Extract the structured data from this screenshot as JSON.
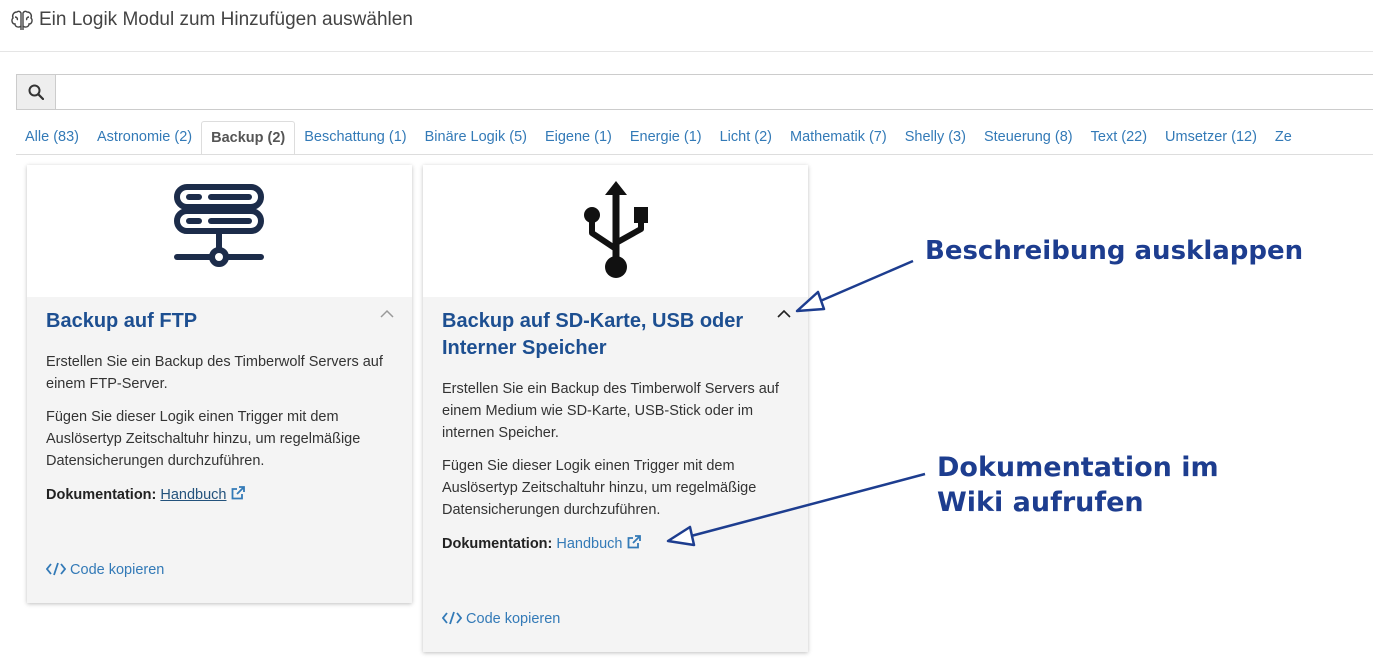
{
  "header": {
    "title": "Ein Logik Modul zum Hinzufügen auswählen",
    "icon": "brain-icon"
  },
  "search": {
    "value": "",
    "icon": "search-icon"
  },
  "tabs": [
    {
      "label": "Alle (83)",
      "active": false
    },
    {
      "label": "Astronomie (2)",
      "active": false
    },
    {
      "label": "Backup (2)",
      "active": true
    },
    {
      "label": "Beschattung (1)",
      "active": false
    },
    {
      "label": "Binäre Logik (5)",
      "active": false
    },
    {
      "label": "Eigene (1)",
      "active": false
    },
    {
      "label": "Energie (1)",
      "active": false
    },
    {
      "label": "Licht (2)",
      "active": false
    },
    {
      "label": "Mathematik (7)",
      "active": false
    },
    {
      "label": "Shelly (3)",
      "active": false
    },
    {
      "label": "Steuerung (8)",
      "active": false
    },
    {
      "label": "Text (22)",
      "active": false
    },
    {
      "label": "Umsetzer (12)",
      "active": false
    },
    {
      "label": "Ze",
      "active": false
    }
  ],
  "cards": [
    {
      "title": "Backup auf FTP",
      "icon": "server-network-icon",
      "desc1": "Erstellen Sie ein Backup des Timberwolf Servers auf einem FTP-Server.",
      "desc2": "Fügen Sie dieser Logik einen Trigger mit dem Auslösertyp Zeitschaltuhr hinzu, um regelmäßige Datensicherungen durchzuführen.",
      "doc_label": "Dokumentation:",
      "doc_link": "Handbuch",
      "code_label": "Code kopieren"
    },
    {
      "title": "Backup auf SD-Karte, USB oder Interner Speicher",
      "icon": "usb-icon",
      "desc1": "Erstellen Sie ein Backup des Timberwolf Servers auf einem Medium wie SD-Karte, USB-Stick oder im internen Speicher.",
      "desc2": "Fügen Sie dieser Logik einen Trigger mit dem Auslösertyp Zeitschaltuhr hinzu, um regelmäßige Datensicherungen durchzuführen.",
      "doc_label": "Dokumentation:",
      "doc_link": "Handbuch",
      "code_label": "Code kopieren"
    }
  ],
  "annotations": {
    "expand": "Beschreibung ausklappen",
    "docs_line1": "Dokumentation im",
    "docs_line2": "Wiki aufrufen"
  },
  "colors": {
    "accent": "#337ab7",
    "title": "#1d4f91",
    "annotation": "#1d3d8f",
    "card_bg": "#f4f4f4"
  }
}
